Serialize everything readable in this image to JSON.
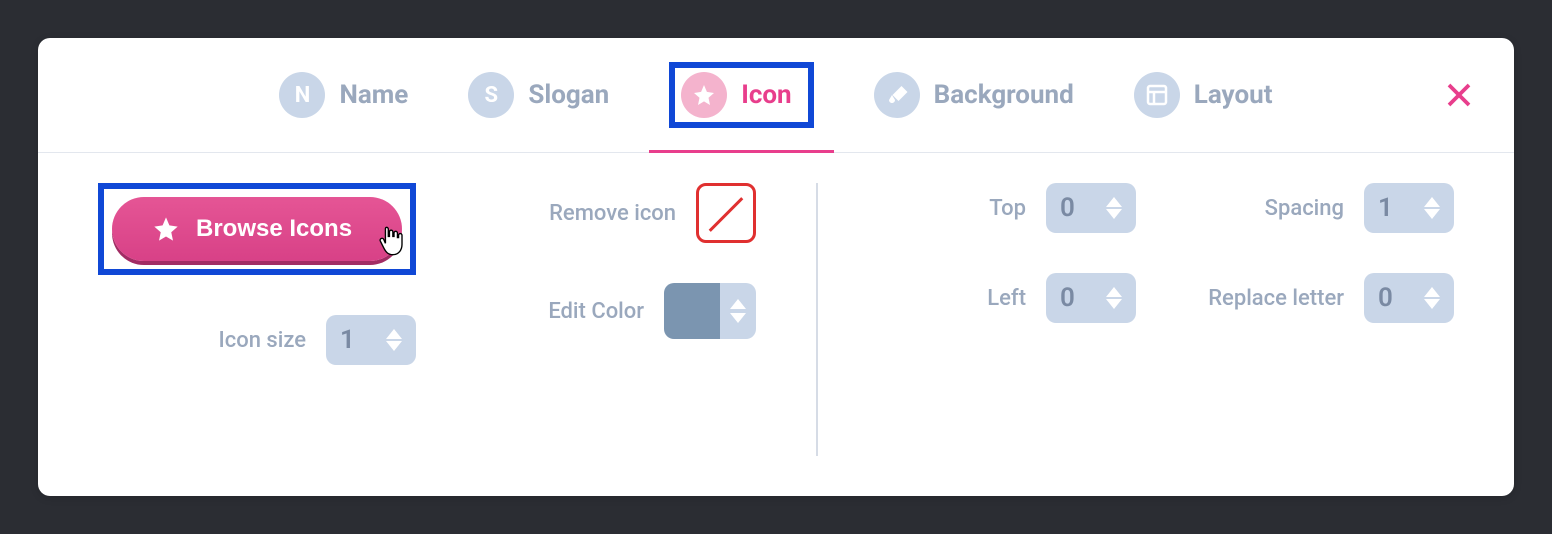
{
  "tabs": {
    "name": {
      "letter": "N",
      "label": "Name"
    },
    "slogan": {
      "letter": "S",
      "label": "Slogan"
    },
    "icon": {
      "label": "Icon"
    },
    "background": {
      "label": "Background"
    },
    "layout": {
      "label": "Layout"
    }
  },
  "active_tab": "icon",
  "browse_button_label": "Browse Icons",
  "controls": {
    "icon_size": {
      "label": "Icon size",
      "value": "1"
    },
    "remove_icon": {
      "label": "Remove icon"
    },
    "edit_color": {
      "label": "Edit Color",
      "swatch": "#7b95b0"
    },
    "top": {
      "label": "Top",
      "value": "0"
    },
    "left": {
      "label": "Left",
      "value": "0"
    },
    "spacing": {
      "label": "Spacing",
      "value": "1"
    },
    "replace_letter": {
      "label": "Replace letter",
      "value": "0"
    }
  },
  "highlights": [
    "tab-icon",
    "browse-icons-button"
  ],
  "colors": {
    "accent": "#e83e8c",
    "highlight_box": "#1048d6"
  }
}
